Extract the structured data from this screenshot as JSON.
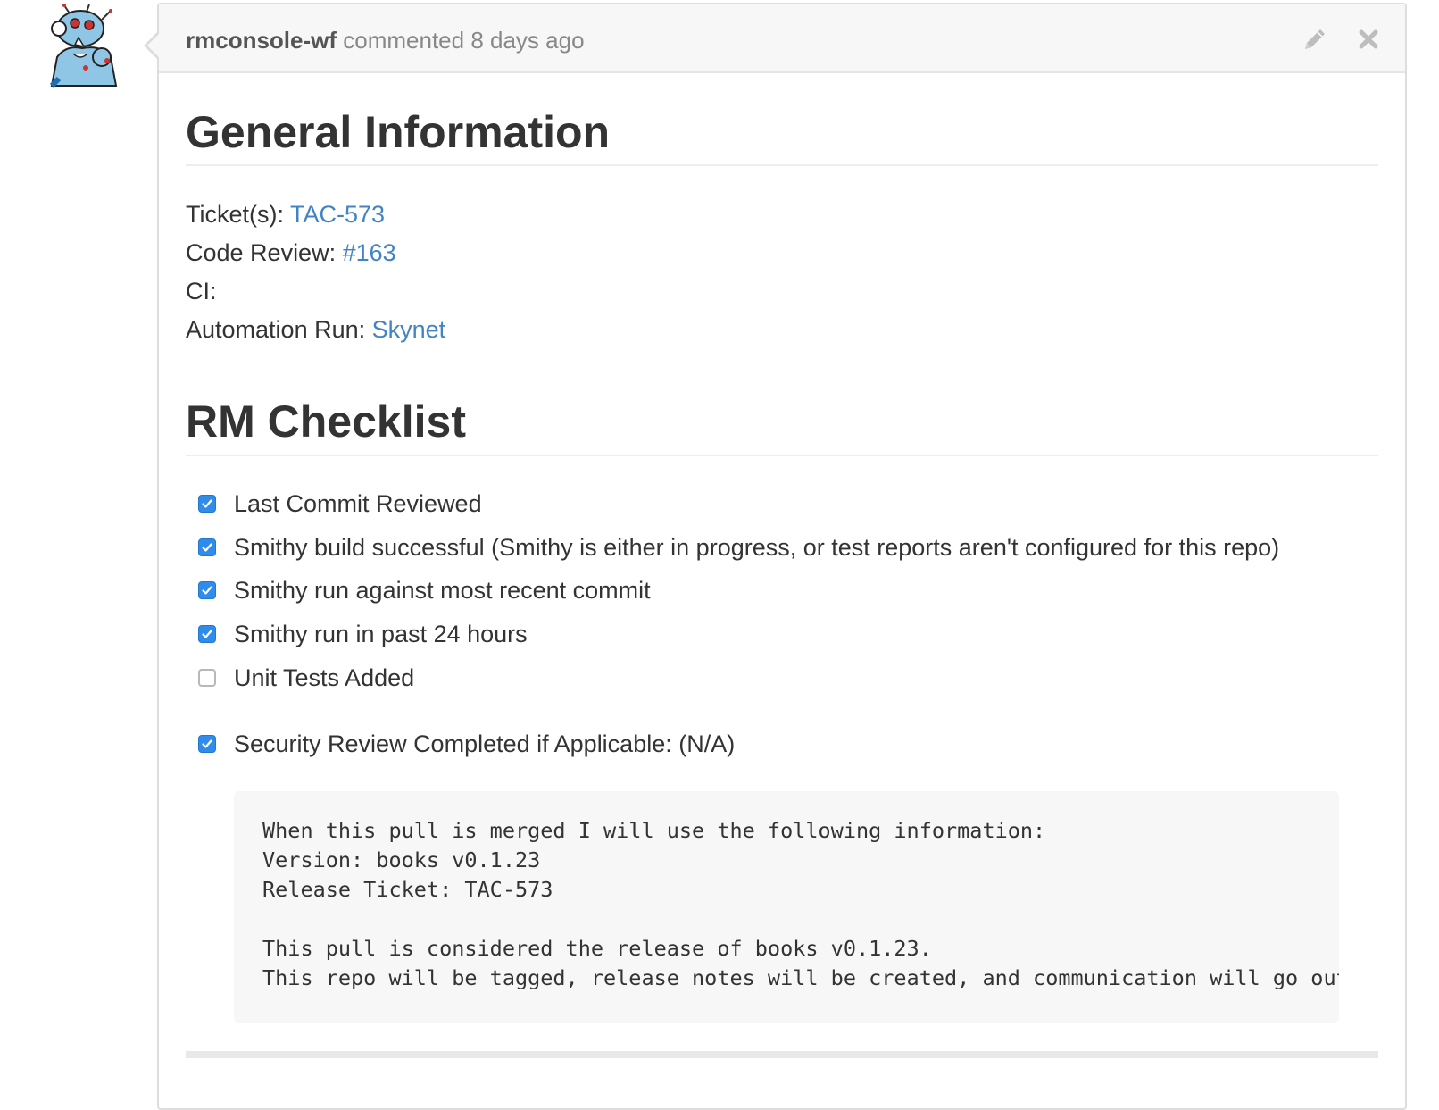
{
  "comment": {
    "author": "rmconsole-wf",
    "meta": " commented 8 days ago",
    "actions": {
      "edit_icon": "pencil-icon",
      "delete_icon": "close-icon"
    }
  },
  "general": {
    "title": "General Information",
    "ticket_label": "Ticket(s): ",
    "ticket_link": "TAC-573",
    "review_label": "Code Review: ",
    "review_link": "#163",
    "ci_label": "CI:",
    "automation_label": "Automation Run: ",
    "automation_link": "Skynet"
  },
  "checklist": {
    "title": "RM Checklist",
    "items": [
      {
        "label": "Last Commit Reviewed",
        "checked": true
      },
      {
        "label": "Smithy build successful (Smithy is either in progress, or test reports aren't configured for this repo)",
        "checked": true
      },
      {
        "label": "Smithy run against most recent commit",
        "checked": true
      },
      {
        "label": "Smithy run in past 24 hours",
        "checked": true
      },
      {
        "label": "Unit Tests Added",
        "checked": false
      },
      {
        "label": "Security Review Completed if Applicable: (N/A)",
        "checked": true
      }
    ]
  },
  "code_block": "When this pull is merged I will use the following information:\nVersion: books v0.1.23\nRelease Ticket: TAC-573\n\nThis pull is considered the release of books v0.1.23.\nThis repo will be tagged, release notes will be created, and communication will go out.",
  "colors": {
    "link": "#4183c4",
    "checkbox": "#2f8cec"
  }
}
